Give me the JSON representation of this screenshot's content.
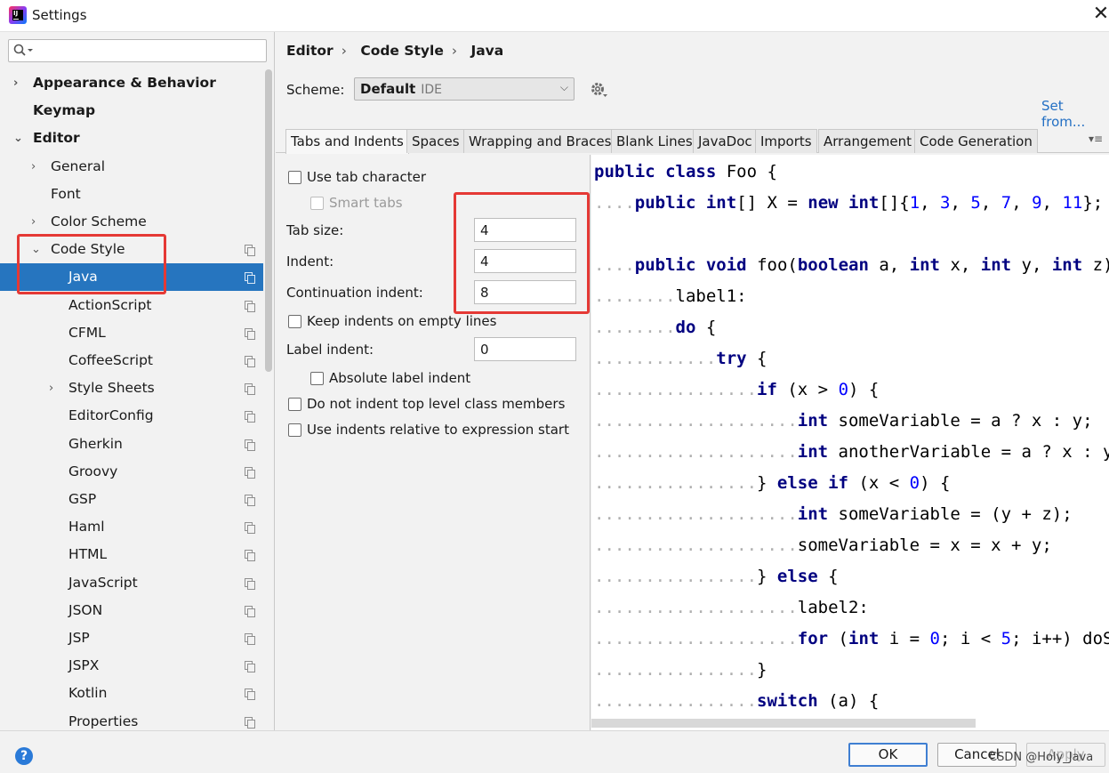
{
  "window": {
    "title": "Settings",
    "close_icon": "close-icon"
  },
  "sidebar": {
    "search_value": "",
    "items": [
      {
        "label": "Appearance & Behavior",
        "level": 0,
        "bold": true,
        "chevron": "›",
        "selected": false,
        "copy": false
      },
      {
        "label": "Keymap",
        "level": 0,
        "bold": true,
        "chevron": "",
        "selected": false,
        "copy": false
      },
      {
        "label": "Editor",
        "level": 0,
        "bold": true,
        "chevron": "⌄",
        "selected": false,
        "copy": false
      },
      {
        "label": "General",
        "level": 1,
        "bold": false,
        "chevron": "›",
        "selected": false,
        "copy": false
      },
      {
        "label": "Font",
        "level": 1,
        "bold": false,
        "chevron": "",
        "selected": false,
        "copy": false
      },
      {
        "label": "Color Scheme",
        "level": 1,
        "bold": false,
        "chevron": "›",
        "selected": false,
        "copy": false
      },
      {
        "label": "Code Style",
        "level": 1,
        "bold": false,
        "chevron": "⌄",
        "selected": false,
        "copy": true
      },
      {
        "label": "Java",
        "level": 2,
        "bold": false,
        "chevron": "",
        "selected": true,
        "copy": true
      },
      {
        "label": "ActionScript",
        "level": 2,
        "bold": false,
        "chevron": "",
        "selected": false,
        "copy": true
      },
      {
        "label": "CFML",
        "level": 2,
        "bold": false,
        "chevron": "",
        "selected": false,
        "copy": true
      },
      {
        "label": "CoffeeScript",
        "level": 2,
        "bold": false,
        "chevron": "",
        "selected": false,
        "copy": true
      },
      {
        "label": "Style Sheets",
        "level": 2,
        "bold": false,
        "chevron": "›",
        "selected": false,
        "copy": true
      },
      {
        "label": "EditorConfig",
        "level": 2,
        "bold": false,
        "chevron": "",
        "selected": false,
        "copy": true
      },
      {
        "label": "Gherkin",
        "level": 2,
        "bold": false,
        "chevron": "",
        "selected": false,
        "copy": true
      },
      {
        "label": "Groovy",
        "level": 2,
        "bold": false,
        "chevron": "",
        "selected": false,
        "copy": true
      },
      {
        "label": "GSP",
        "level": 2,
        "bold": false,
        "chevron": "",
        "selected": false,
        "copy": true
      },
      {
        "label": "Haml",
        "level": 2,
        "bold": false,
        "chevron": "",
        "selected": false,
        "copy": true
      },
      {
        "label": "HTML",
        "level": 2,
        "bold": false,
        "chevron": "",
        "selected": false,
        "copy": true
      },
      {
        "label": "JavaScript",
        "level": 2,
        "bold": false,
        "chevron": "",
        "selected": false,
        "copy": true
      },
      {
        "label": "JSON",
        "level": 2,
        "bold": false,
        "chevron": "",
        "selected": false,
        "copy": true
      },
      {
        "label": "JSP",
        "level": 2,
        "bold": false,
        "chevron": "",
        "selected": false,
        "copy": true
      },
      {
        "label": "JSPX",
        "level": 2,
        "bold": false,
        "chevron": "",
        "selected": false,
        "copy": true
      },
      {
        "label": "Kotlin",
        "level": 2,
        "bold": false,
        "chevron": "",
        "selected": false,
        "copy": true
      },
      {
        "label": "Properties",
        "level": 2,
        "bold": false,
        "chevron": "",
        "selected": false,
        "copy": true
      }
    ]
  },
  "breadcrumb": [
    "Editor",
    "Code Style",
    "Java"
  ],
  "scheme": {
    "label": "Scheme:",
    "value": "Default",
    "suffix": "IDE",
    "set_from": "Set from..."
  },
  "tabs": [
    "Tabs and Indents",
    "Spaces",
    "Wrapping and Braces",
    "Blank Lines",
    "JavaDoc",
    "Imports",
    "Arrangement",
    "Code Generation"
  ],
  "active_tab": "Tabs and Indents",
  "options": {
    "use_tab_character": {
      "label": "Use tab character",
      "checked": false
    },
    "smart_tabs": {
      "label": "Smart tabs",
      "checked": false,
      "disabled": true
    },
    "tab_size": {
      "label": "Tab size:",
      "value": "4"
    },
    "indent": {
      "label": "Indent:",
      "value": "4"
    },
    "continuation_indent": {
      "label": "Continuation indent:",
      "value": "8"
    },
    "keep_indents_empty": {
      "label": "Keep indents on empty lines",
      "checked": false
    },
    "label_indent": {
      "label": "Label indent:",
      "value": "0"
    },
    "absolute_label_indent": {
      "label": "Absolute label indent",
      "checked": false
    },
    "no_indent_top_level": {
      "label": "Do not indent top level class members",
      "checked": false
    },
    "relative_indents": {
      "label": "Use indents relative to expression start",
      "checked": false
    }
  },
  "code_preview": [
    {
      "indent": 0,
      "tokens": [
        [
          "kw",
          "public"
        ],
        [
          "",
          " "
        ],
        [
          "kw",
          "class"
        ],
        [
          "",
          " Foo {"
        ]
      ]
    },
    {
      "indent": 1,
      "tokens": [
        [
          "kw",
          "public"
        ],
        [
          "",
          " "
        ],
        [
          "kw",
          "int"
        ],
        [
          "",
          "[] X = "
        ],
        [
          "kw",
          "new"
        ],
        [
          "",
          " "
        ],
        [
          "kw",
          "int"
        ],
        [
          "",
          "[]{"
        ],
        [
          "num",
          "1"
        ],
        [
          "",
          ", "
        ],
        [
          "num",
          "3"
        ],
        [
          "",
          ", "
        ],
        [
          "num",
          "5"
        ],
        [
          "",
          ", "
        ],
        [
          "num",
          "7"
        ],
        [
          "",
          ", "
        ],
        [
          "num",
          "9"
        ],
        [
          "",
          ", "
        ],
        [
          "num",
          "11"
        ],
        [
          "",
          "};"
        ]
      ]
    },
    {
      "indent": 0,
      "tokens": []
    },
    {
      "indent": 1,
      "tokens": [
        [
          "kw",
          "public"
        ],
        [
          "",
          " "
        ],
        [
          "kw",
          "void"
        ],
        [
          "",
          " foo("
        ],
        [
          "kw",
          "boolean"
        ],
        [
          "",
          " a, "
        ],
        [
          "kw",
          "int"
        ],
        [
          "",
          " x, "
        ],
        [
          "kw",
          "int"
        ],
        [
          "",
          " y, "
        ],
        [
          "kw",
          "int"
        ],
        [
          "",
          " z) {"
        ]
      ]
    },
    {
      "indent": 2,
      "tokens": [
        [
          "",
          "label1:"
        ]
      ]
    },
    {
      "indent": 2,
      "tokens": [
        [
          "kw",
          "do"
        ],
        [
          "",
          " {"
        ]
      ]
    },
    {
      "indent": 3,
      "tokens": [
        [
          "kw",
          "try"
        ],
        [
          "",
          " {"
        ]
      ]
    },
    {
      "indent": 4,
      "tokens": [
        [
          "kw",
          "if"
        ],
        [
          "",
          " (x > "
        ],
        [
          "num",
          "0"
        ],
        [
          "",
          ") {"
        ]
      ]
    },
    {
      "indent": 5,
      "tokens": [
        [
          "kw",
          "int"
        ],
        [
          "",
          " someVariable = a ? x : y;"
        ]
      ]
    },
    {
      "indent": 5,
      "tokens": [
        [
          "kw",
          "int"
        ],
        [
          "",
          " anotherVariable = a ? x : y;"
        ]
      ]
    },
    {
      "indent": 4,
      "tokens": [
        [
          "",
          "} "
        ],
        [
          "kw",
          "else if"
        ],
        [
          "",
          " (x < "
        ],
        [
          "num",
          "0"
        ],
        [
          "",
          ") {"
        ]
      ]
    },
    {
      "indent": 5,
      "tokens": [
        [
          "kw",
          "int"
        ],
        [
          "",
          " someVariable = (y + z);"
        ]
      ]
    },
    {
      "indent": 5,
      "tokens": [
        [
          "",
          "someVariable = x = x + y;"
        ]
      ]
    },
    {
      "indent": 4,
      "tokens": [
        [
          "",
          "} "
        ],
        [
          "kw",
          "else"
        ],
        [
          "",
          " {"
        ]
      ]
    },
    {
      "indent": 5,
      "tokens": [
        [
          "",
          "label2:"
        ]
      ]
    },
    {
      "indent": 5,
      "tokens": [
        [
          "kw",
          "for"
        ],
        [
          "",
          " ("
        ],
        [
          "kw",
          "int"
        ],
        [
          "",
          " i = "
        ],
        [
          "num",
          "0"
        ],
        [
          "",
          "; i < "
        ],
        [
          "num",
          "5"
        ],
        [
          "",
          "; i++) doSomething(i);"
        ]
      ]
    },
    {
      "indent": 4,
      "tokens": [
        [
          "",
          "}"
        ]
      ]
    },
    {
      "indent": 4,
      "tokens": [
        [
          "kw",
          "switch"
        ],
        [
          "",
          " (a) {"
        ]
      ]
    }
  ],
  "footer": {
    "help": "?",
    "ok": "OK",
    "cancel": "Cancel",
    "apply": "Apply",
    "watermark": "CSDN @Holy_Java"
  },
  "colors": {
    "selection": "#2675bf",
    "highlight_box": "#e53935",
    "keyword": "#000080",
    "number": "#0000ff",
    "link": "#2470c4"
  }
}
